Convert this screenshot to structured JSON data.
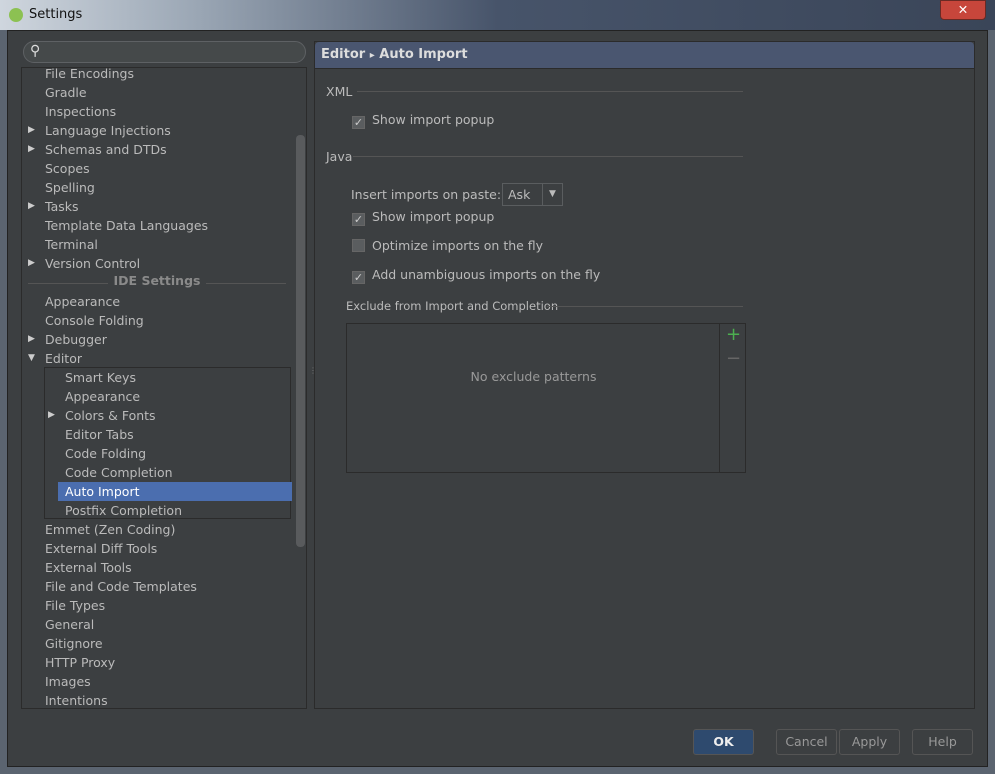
{
  "window": {
    "title": "Settings",
    "close": "✕"
  },
  "search": {
    "placeholder": ""
  },
  "tree": {
    "items_top": [
      {
        "label": "File Encodings"
      },
      {
        "label": "Gradle"
      },
      {
        "label": "Inspections"
      },
      {
        "label": "Language Injections",
        "expandable": true
      },
      {
        "label": "Schemas and DTDs",
        "expandable": true
      },
      {
        "label": "Scopes"
      },
      {
        "label": "Spelling"
      },
      {
        "label": "Tasks",
        "expandable": true
      },
      {
        "label": "Template Data Languages"
      },
      {
        "label": "Terminal"
      },
      {
        "label": "Version Control",
        "expandable": true
      }
    ],
    "section": "IDE Settings",
    "items_ide": [
      {
        "label": "Appearance"
      },
      {
        "label": "Console Folding"
      },
      {
        "label": "Debugger",
        "expandable": true
      },
      {
        "label": "Editor",
        "expanded": true
      }
    ],
    "editor_children": [
      {
        "label": "Smart Keys"
      },
      {
        "label": "Appearance"
      },
      {
        "label": "Colors & Fonts",
        "expandable": true
      },
      {
        "label": "Editor Tabs"
      },
      {
        "label": "Code Folding"
      },
      {
        "label": "Code Completion"
      },
      {
        "label": "Auto Import",
        "selected": true
      },
      {
        "label": "Postfix Completion"
      }
    ],
    "items_bottom": [
      {
        "label": "Emmet (Zen Coding)"
      },
      {
        "label": "External Diff Tools"
      },
      {
        "label": "External Tools"
      },
      {
        "label": "File and Code Templates"
      },
      {
        "label": "File Types"
      },
      {
        "label": "General"
      },
      {
        "label": "Gitignore"
      },
      {
        "label": "HTTP Proxy"
      },
      {
        "label": "Images"
      },
      {
        "label": "Intentions"
      }
    ]
  },
  "header": {
    "parent": "Editor",
    "sep": "▸",
    "current": "Auto Import"
  },
  "xml": {
    "title": "XML",
    "show_popup": {
      "label": "Show import popup",
      "checked": true
    }
  },
  "java": {
    "title": "Java",
    "insert_label": "Insert imports on paste:",
    "insert_value": "Ask",
    "checks": [
      {
        "label": "Show import popup",
        "checked": true
      },
      {
        "label": "Optimize imports on the fly",
        "checked": false
      },
      {
        "label": "Add unambiguous imports on the fly",
        "checked": true
      }
    ]
  },
  "exclude": {
    "title": "Exclude from Import and Completion",
    "empty": "No exclude patterns",
    "add": "+",
    "remove": "−"
  },
  "buttons": {
    "ok": "OK",
    "cancel": "Cancel",
    "apply": "Apply",
    "help": "Help"
  },
  "colors": {
    "selection": "#4b6eaf",
    "header": "#4a5670",
    "add": "#4caf50"
  }
}
